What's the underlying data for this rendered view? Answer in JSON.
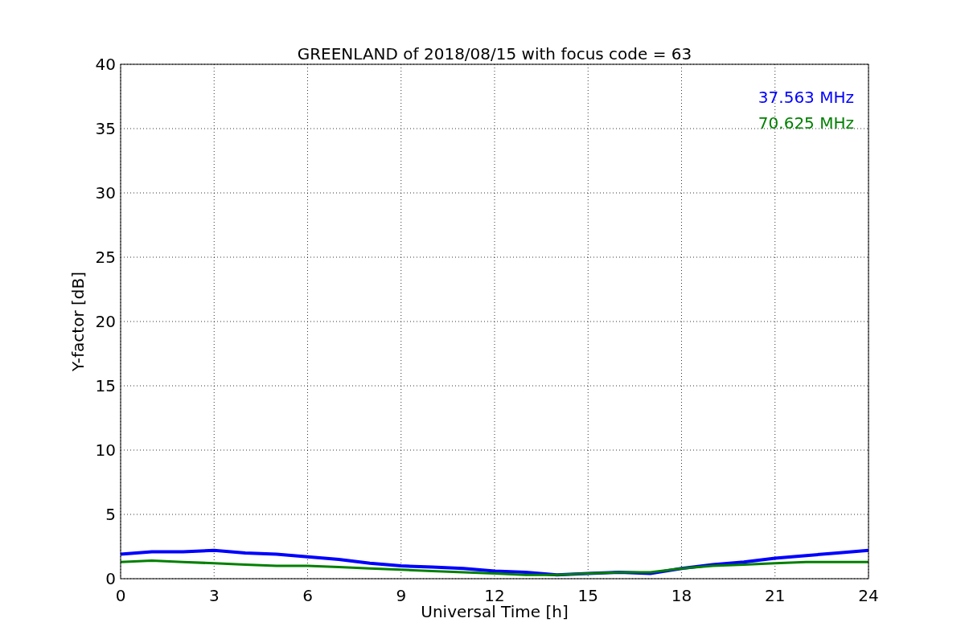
{
  "chart_data": {
    "type": "line",
    "title": "GREENLAND of 2018/08/15 with focus code = 63",
    "xlabel": "Universal Time [h]",
    "ylabel": "Y-factor [dB]",
    "x": [
      0,
      1,
      2,
      3,
      4,
      5,
      6,
      7,
      8,
      9,
      10,
      11,
      12,
      13,
      14,
      15,
      16,
      17,
      18,
      19,
      20,
      21,
      22,
      23,
      24
    ],
    "series": [
      {
        "name": "37.563 MHz",
        "color": "#0000ff",
        "values": [
          1.9,
          2.1,
          2.1,
          2.2,
          2.0,
          1.9,
          1.7,
          1.5,
          1.2,
          1.0,
          0.9,
          0.8,
          0.6,
          0.5,
          0.3,
          0.4,
          0.5,
          0.4,
          0.8,
          1.1,
          1.3,
          1.6,
          1.8,
          2.0,
          2.2
        ]
      },
      {
        "name": "70.625 MHz",
        "color": "#008000",
        "values": [
          1.3,
          1.4,
          1.3,
          1.2,
          1.1,
          1.0,
          1.0,
          0.9,
          0.8,
          0.7,
          0.6,
          0.5,
          0.4,
          0.3,
          0.3,
          0.4,
          0.5,
          0.5,
          0.8,
          1.0,
          1.1,
          1.2,
          1.3,
          1.3,
          1.3
        ]
      }
    ],
    "xlim": [
      0,
      24
    ],
    "ylim": [
      0,
      40
    ],
    "xticks": [
      0,
      3,
      6,
      9,
      12,
      15,
      18,
      21,
      24
    ],
    "yticks": [
      0,
      5,
      10,
      15,
      20,
      25,
      30,
      35,
      40
    ],
    "grid": true
  }
}
